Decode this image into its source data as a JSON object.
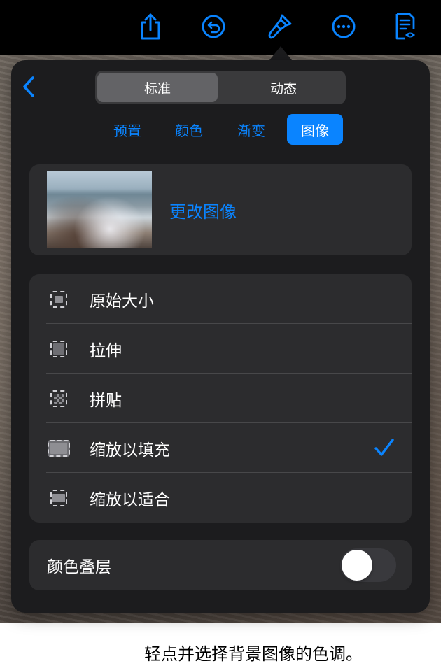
{
  "toolbar": {
    "icons": [
      "share-icon",
      "undo-icon",
      "paintbrush-icon",
      "more-icon",
      "reader-view-icon"
    ]
  },
  "popover": {
    "segments": [
      {
        "label": "标准",
        "selected": true
      },
      {
        "label": "动态",
        "selected": false
      }
    ],
    "tabs": [
      {
        "label": "预置",
        "selected": false
      },
      {
        "label": "颜色",
        "selected": false
      },
      {
        "label": "渐变",
        "selected": false
      },
      {
        "label": "图像",
        "selected": true
      }
    ],
    "image_card": {
      "change_label": "更改图像"
    },
    "options": [
      {
        "label": "原始大小",
        "icon": "original-size-icon",
        "checked": false
      },
      {
        "label": "拉伸",
        "icon": "stretch-icon",
        "checked": false
      },
      {
        "label": "拼贴",
        "icon": "tile-icon",
        "checked": false
      },
      {
        "label": "缩放以填充",
        "icon": "scale-to-fill-icon",
        "checked": true
      },
      {
        "label": "缩放以适合",
        "icon": "scale-to-fit-icon",
        "checked": false
      }
    ],
    "color_overlay": {
      "label": "颜色叠层",
      "on": false
    }
  },
  "callout": {
    "text": "轻点并选择背景图像的色调。"
  },
  "colors": {
    "accent": "#0a84ff",
    "popover_bg": "#1c1c1e",
    "card_bg": "#2c2c2e"
  }
}
